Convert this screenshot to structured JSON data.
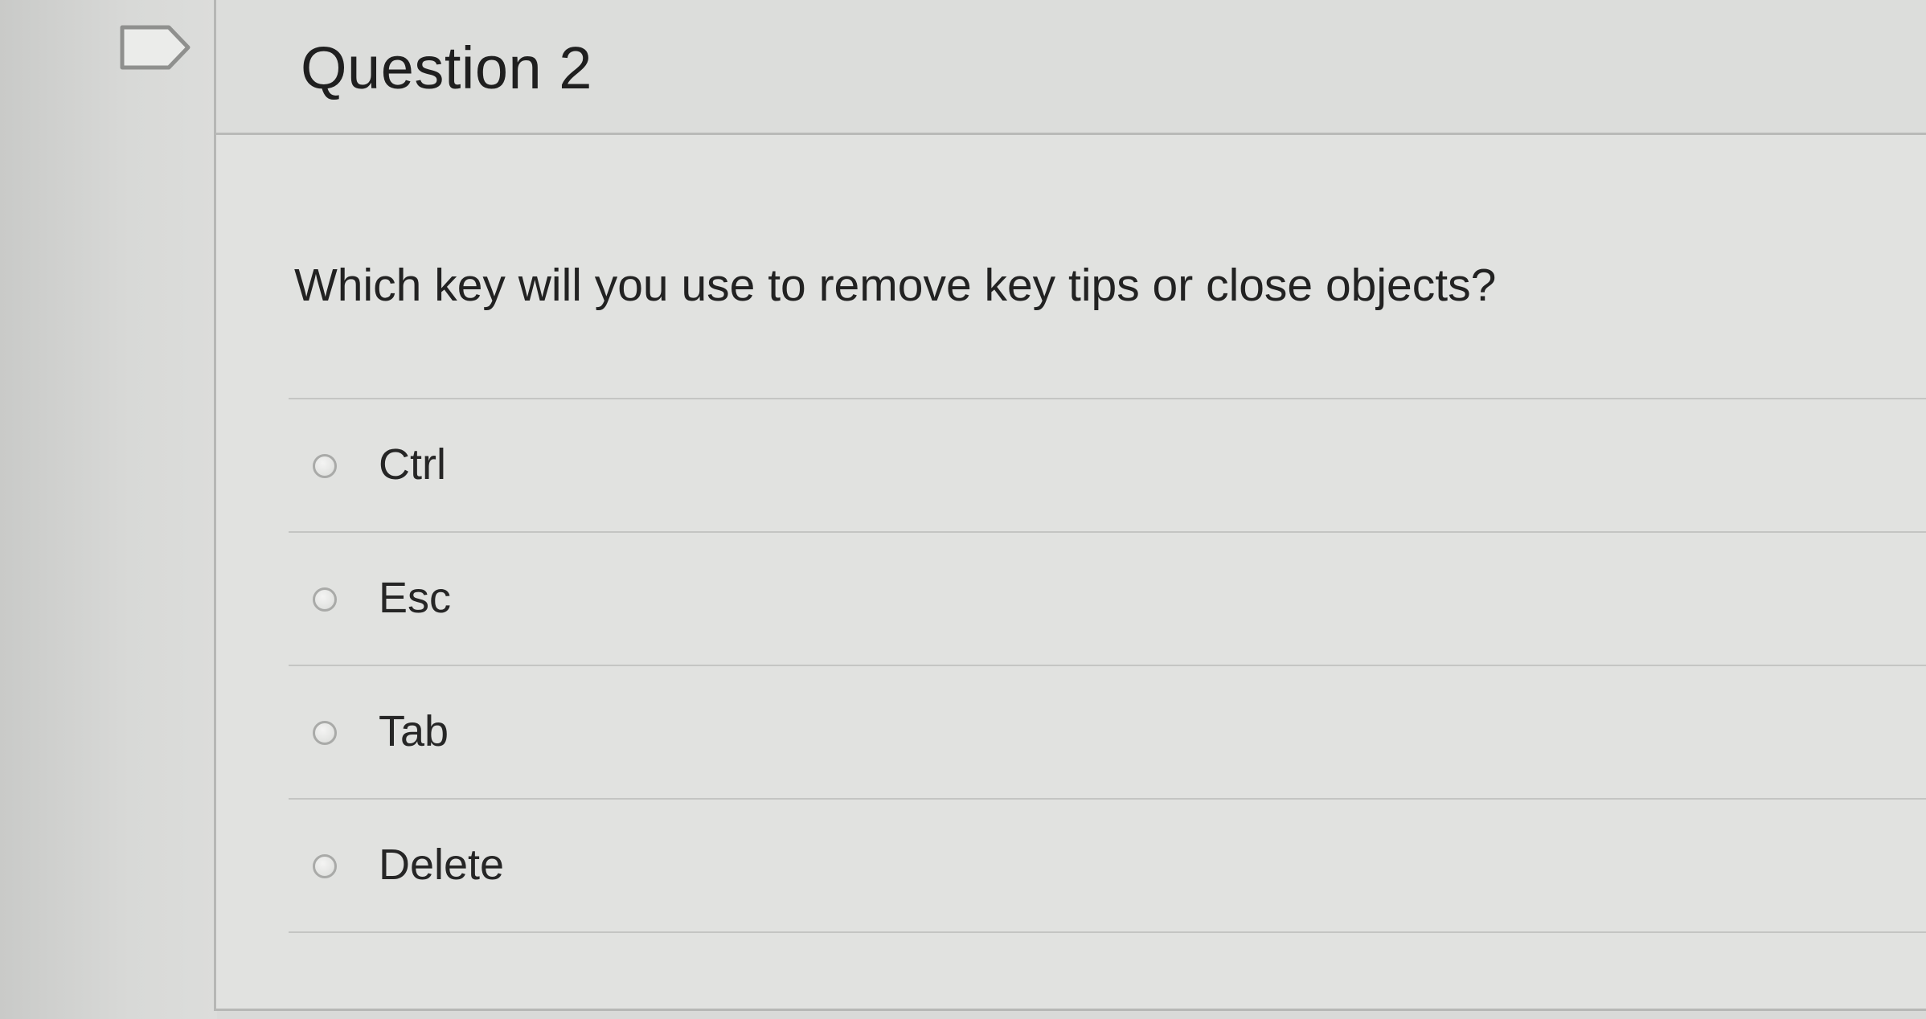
{
  "question": {
    "title": "Question 2",
    "prompt": "Which key will you use to remove key tips or close objects?",
    "flag_icon": "flag-outline-icon",
    "answers": [
      {
        "label": "Ctrl",
        "selected": false
      },
      {
        "label": "Esc",
        "selected": false
      },
      {
        "label": "Tab",
        "selected": false
      },
      {
        "label": "Delete",
        "selected": false
      }
    ]
  },
  "colors": {
    "background": "#d9dad8",
    "card": "#e1e2e0",
    "text": "#222222",
    "divider": "#c4c5c3"
  }
}
